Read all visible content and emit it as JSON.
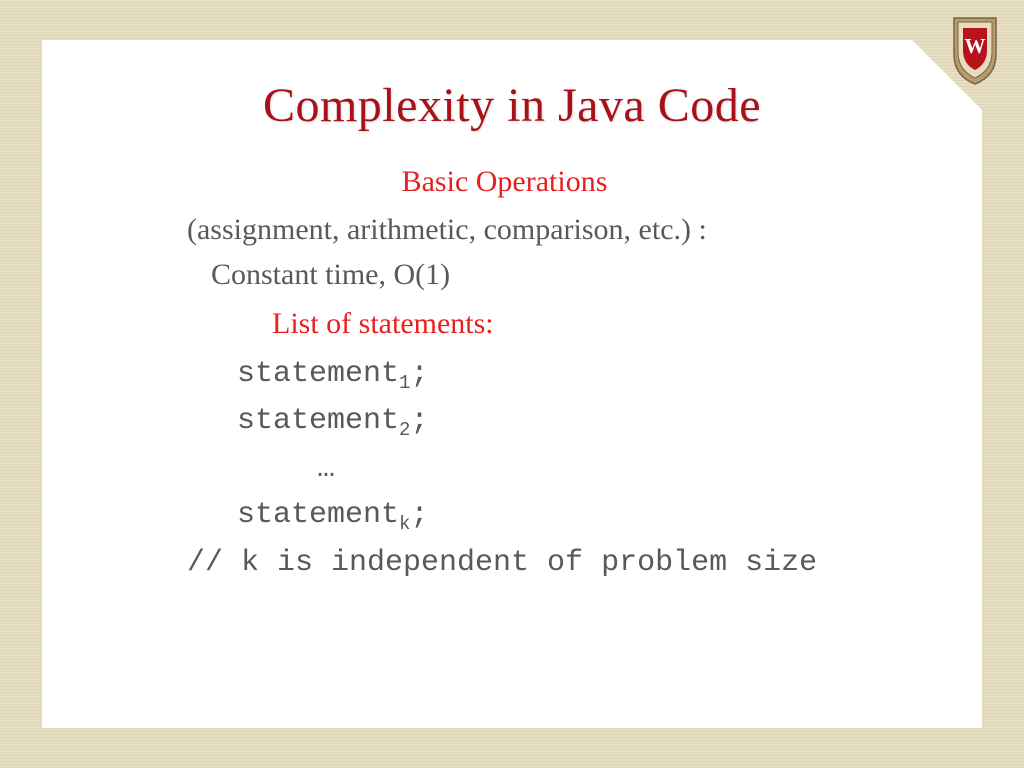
{
  "slide": {
    "title": "Complexity in Java Code",
    "section1_heading": "Basic Operations",
    "section1_sub": "(assignment, arithmetic, comparison, etc.) :",
    "section1_note": "Constant time, O(1)",
    "section2_heading": "List of statements:",
    "code": {
      "stmt_prefix": "statement",
      "sub1": "1",
      "sub2": "2",
      "subk": "k",
      "semi": ";",
      "ellipsis": "…",
      "comment": "// k is independent of problem size"
    }
  },
  "crest": {
    "letter": "W"
  }
}
